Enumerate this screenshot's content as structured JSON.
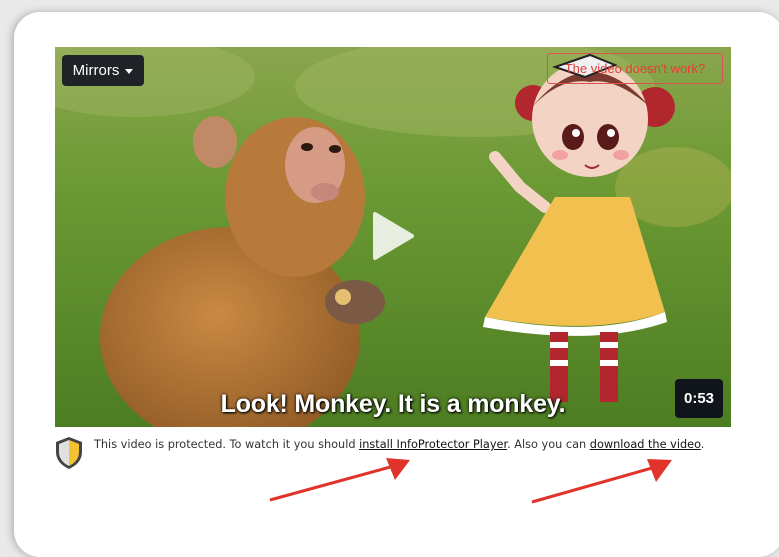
{
  "player": {
    "mirrors_label": "Mirrors",
    "report_label": "The video doesn't work?",
    "subtitle": "Look! Monkey. It is a monkey.",
    "duration": "0:53"
  },
  "notice": {
    "text_before": "This video is protected. To watch it you should ",
    "install_link": "install InfoProtector Player",
    "text_middle": ". Also you can ",
    "download_link": "download the video",
    "text_after": "."
  },
  "colors": {
    "arrow": "#e0332a",
    "report": "#e0403a",
    "grass": "#5d8b2c"
  }
}
